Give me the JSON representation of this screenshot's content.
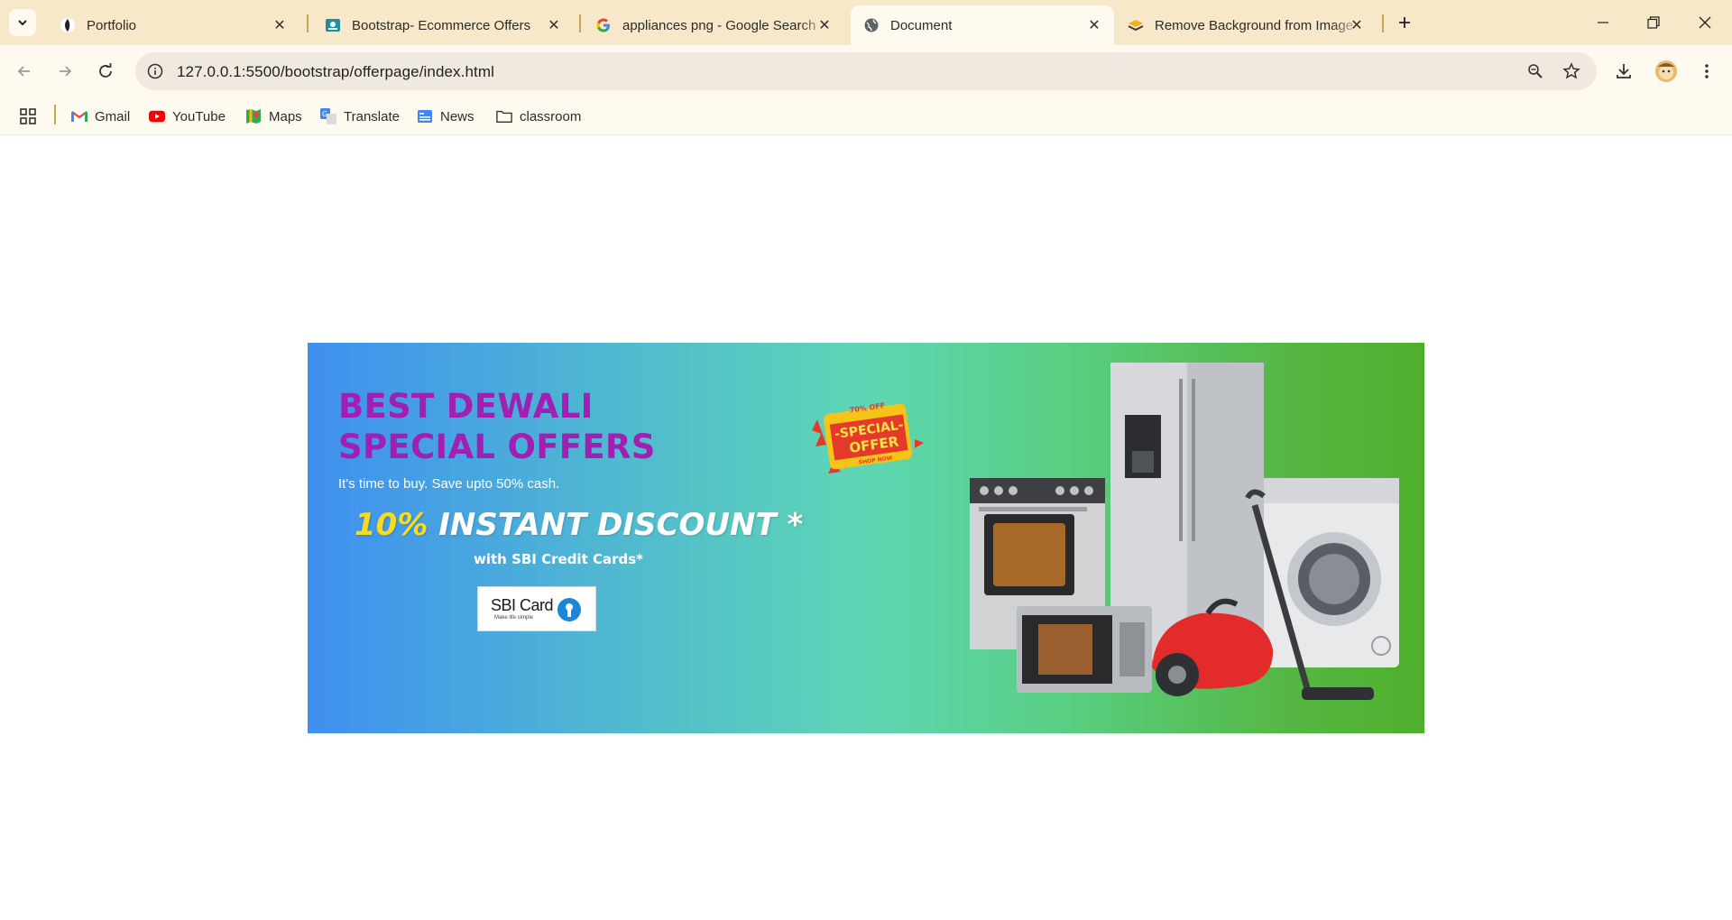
{
  "browser": {
    "tabs": [
      {
        "title": "Portfolio",
        "active": false
      },
      {
        "title": "Bootstrap- Ecommerce Offers",
        "active": false
      },
      {
        "title": "appliances png - Google Search",
        "active": false
      },
      {
        "title": "Document",
        "active": true
      },
      {
        "title": "Remove Background from Image",
        "active": false
      }
    ],
    "url": "127.0.0.1:5500/bootstrap/offerpage/index.html",
    "bookmarks": [
      "Gmail",
      "YouTube",
      "Maps",
      "Translate",
      "News",
      "classroom"
    ]
  },
  "banner": {
    "headline": "BEST DEWALI SPECIAL OFFERS",
    "subline": "It's time to buy. Save upto 50% cash.",
    "discount_pct": "10%",
    "discount_text": " INSTANT DISCOUNT *",
    "credit_text": "with SBI Credit Cards*",
    "sbi_brand": "SBI Card",
    "sbi_tag": "Make life simple",
    "sticker_top": "70% OFF",
    "sticker_main_1": "-SPECIAL-",
    "sticker_main_2": "OFFER",
    "sticker_bottom": "SHOP NOW"
  },
  "colors": {
    "headline": "#a11fb2",
    "discount_pct": "#f7dc1e",
    "tabstrip": "#f6e8c8"
  }
}
